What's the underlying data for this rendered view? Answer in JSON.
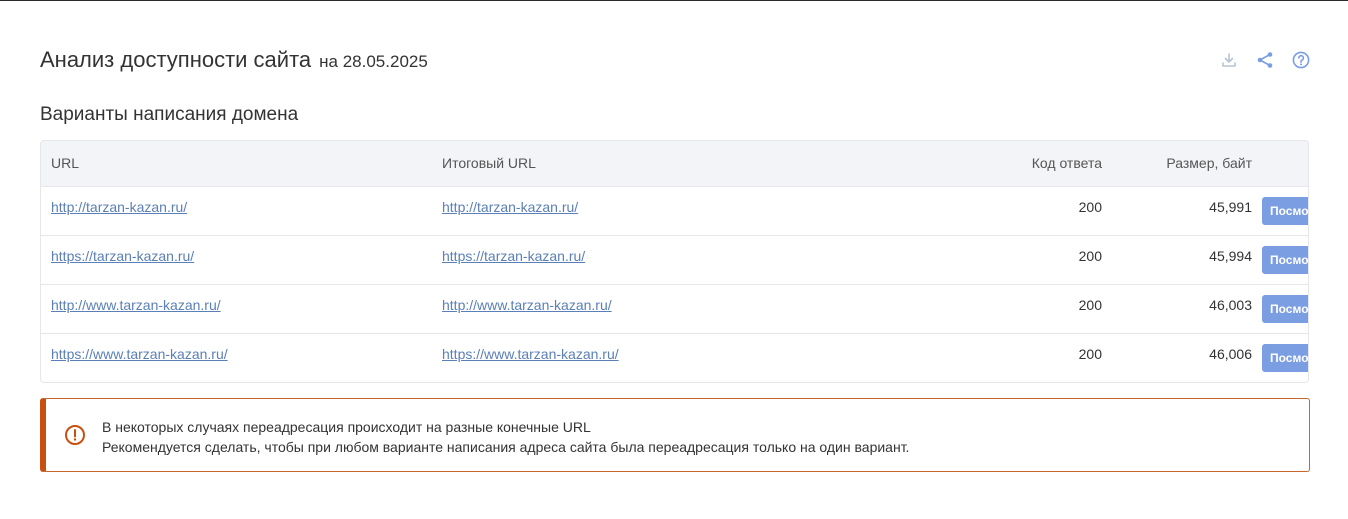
{
  "header": {
    "title": "Анализ доступности сайта",
    "date": "на 28.05.2025"
  },
  "tools": {
    "download_icon": "download-icon",
    "share_icon": "share-icon",
    "help_icon": "help-icon"
  },
  "section": {
    "title": "Варианты написания домена"
  },
  "table": {
    "headers": {
      "url": "URL",
      "final_url": "Итоговый URL",
      "code": "Код ответа",
      "size": "Размер, байт"
    },
    "rows": [
      {
        "url": "http://tarzan-kazan.ru/",
        "final_url": "http://tarzan-kazan.ru/",
        "code": "200",
        "size": "45,991",
        "action": "Посмотреть"
      },
      {
        "url": "https://tarzan-kazan.ru/",
        "final_url": "https://tarzan-kazan.ru/",
        "code": "200",
        "size": "45,994",
        "action": "Посмотреть"
      },
      {
        "url": "http://www.tarzan-kazan.ru/",
        "final_url": "http://www.tarzan-kazan.ru/",
        "code": "200",
        "size": "46,003",
        "action": "Посмотреть"
      },
      {
        "url": "https://www.tarzan-kazan.ru/",
        "final_url": "https://www.tarzan-kazan.ru/",
        "code": "200",
        "size": "46,006",
        "action": "Посмотреть"
      }
    ]
  },
  "alert": {
    "icon": "warning-icon",
    "line1": "В некоторых случаях переадресация происходит на разные конечные URL",
    "line2": "Рекомендуется сделать, чтобы при любом варианте написания адреса сайта была переадресация только на один вариант."
  },
  "colors": {
    "link": "#5b7fb7",
    "button": "#7b9de2",
    "alert_border": "#c8500f",
    "icon": "#7b9de2"
  }
}
